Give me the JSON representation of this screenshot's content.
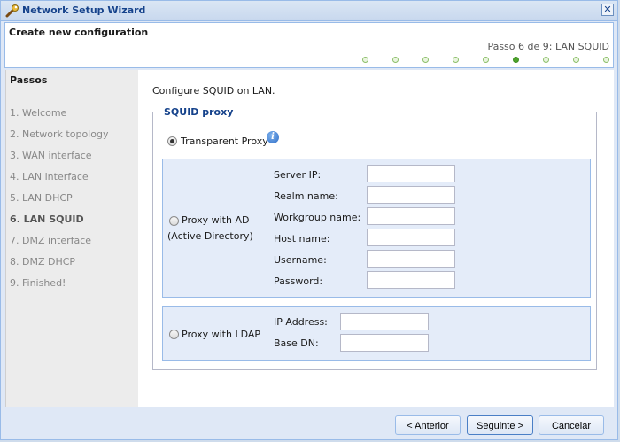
{
  "window": {
    "title": "Network Setup Wizard",
    "close_glyph": "✕"
  },
  "header": {
    "title": "Create new configuration",
    "step_indicator": "Passo 6 de 9: LAN SQUID",
    "total_steps": 9,
    "current_step": 6
  },
  "sidebar": {
    "title": "Passos",
    "steps": [
      "1. Welcome",
      "2. Network topology",
      "3. WAN interface",
      "4. LAN interface",
      "5. LAN DHCP",
      "6. LAN SQUID",
      "7. DMZ interface",
      "8. DMZ DHCP",
      "9. Finished!"
    ]
  },
  "main": {
    "intro": "Configure SQUID on LAN.",
    "fieldset_title": "SQUID proxy",
    "transparent": {
      "label": "Transparent Proxy",
      "selected": true,
      "info_icon": "info-icon"
    },
    "ad": {
      "label_line1": "Proxy with AD",
      "label_line2": "(Active Directory)",
      "selected": false,
      "fields": [
        {
          "label": "Server IP:",
          "value": ""
        },
        {
          "label": "Realm name:",
          "value": ""
        },
        {
          "label": "Workgroup name:",
          "value": ""
        },
        {
          "label": "Host name:",
          "value": ""
        },
        {
          "label": "Username:",
          "value": ""
        },
        {
          "label": "Password:",
          "value": ""
        }
      ]
    },
    "ldap": {
      "label": "Proxy with LDAP",
      "selected": false,
      "fields": [
        {
          "label": "IP Address:",
          "value": ""
        },
        {
          "label": "Base DN:",
          "value": ""
        }
      ]
    }
  },
  "footer": {
    "back": "< Anterior",
    "next": "Seguinte >",
    "cancel": "Cancelar"
  }
}
